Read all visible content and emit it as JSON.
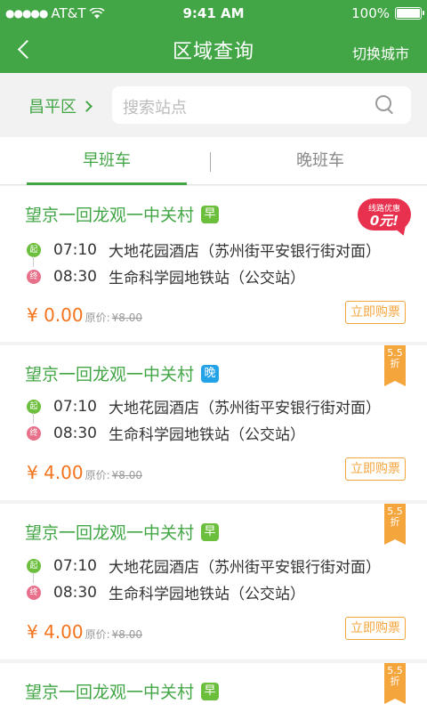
{
  "status_bar": {
    "carrier": "AT&T",
    "time": "9:41 AM",
    "battery": "100%"
  },
  "nav": {
    "title": "区域查询",
    "switch_city": "切换城市"
  },
  "search": {
    "district": "昌平区",
    "placeholder": "搜索站点"
  },
  "tabs": [
    {
      "label": "早班车",
      "active": true
    },
    {
      "label": "晚班车",
      "active": false
    }
  ],
  "cards": [
    {
      "route": "望京一回龙观一中关村",
      "tag": "早",
      "tag_color": "#6cbf3c",
      "start_badge": "起",
      "start_time": "07:10",
      "start_place": "大地花园酒店（苏州街平安银行街对面）",
      "end_badge": "终",
      "end_time": "08:30",
      "end_place": "生命科学园地铁站（公交站）",
      "price": "¥ 0.00",
      "orig_label": "原价:",
      "orig_price": "¥8.00",
      "buy": "立即购票",
      "promo_small": "线路优惠",
      "promo_big": "0元!"
    },
    {
      "route": "望京一回龙观一中关村",
      "tag": "晚",
      "tag_color": "#23a2e8",
      "start_badge": "起",
      "start_time": "07:10",
      "start_place": "大地花园酒店（苏州街平安银行街对面）",
      "end_badge": "终",
      "end_time": "08:30",
      "end_place": "生命科学园地铁站（公交站）",
      "price": "¥ 4.00",
      "orig_label": "原价:",
      "orig_price": "¥8.00",
      "buy": "立即购票",
      "discount_num": "5.5",
      "discount_unit": "折"
    },
    {
      "route": "望京一回龙观一中关村",
      "tag": "早",
      "tag_color": "#6cbf3c",
      "start_badge": "起",
      "start_time": "07:10",
      "start_place": "大地花园酒店（苏州街平安银行街对面）",
      "end_badge": "终",
      "end_time": "08:30",
      "end_place": "生命科学园地铁站（公交站）",
      "price": "¥ 4.00",
      "orig_label": "原价:",
      "orig_price": "¥8.00",
      "buy": "立即购票",
      "discount_num": "5.5",
      "discount_unit": "折"
    },
    {
      "route": "望京一回龙观一中关村",
      "tag": "早",
      "tag_color": "#6cbf3c",
      "discount_num": "5.5",
      "discount_unit": "折"
    }
  ]
}
